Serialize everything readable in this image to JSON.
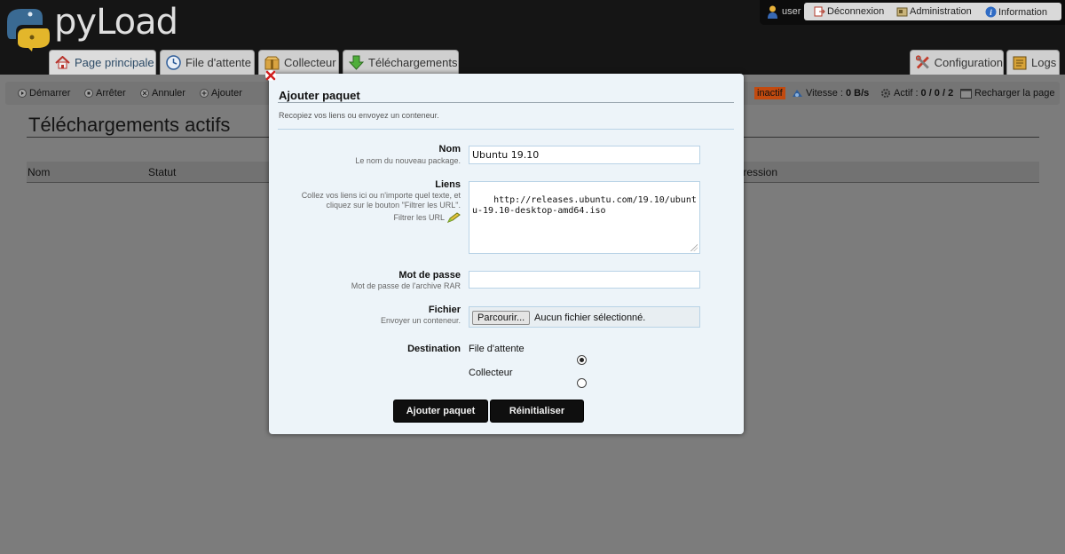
{
  "app": {
    "logo_text": "pyLoad"
  },
  "user": {
    "name": "user",
    "links": {
      "logout": "Déconnexion",
      "admin": "Administration",
      "info": "Information"
    }
  },
  "tabs": {
    "home": "Page principale",
    "queue": "File d'attente",
    "collector": "Collecteur",
    "downloads": "Téléchargements",
    "config": "Configuration",
    "logs": "Logs"
  },
  "actions": {
    "start": "Démarrer",
    "stop": "Arrêter",
    "cancel": "Annuler",
    "add": "Ajouter"
  },
  "status": {
    "state": "inactif",
    "speed_label": "Vitesse : ",
    "speed_value": "0 B/s",
    "active_label": "Actif : ",
    "active_value": "0 / 0 / 2",
    "reload": "Recharger la page"
  },
  "page": {
    "title": "Téléchargements actifs",
    "columns": {
      "name": "Nom",
      "status": "Statut",
      "progress": "Progression"
    }
  },
  "modal": {
    "title": "Ajouter paquet",
    "subtitle": "Recopiez vos liens ou envoyez un conteneur.",
    "name_label": "Nom",
    "name_desc": "Le nom du nouveau package.",
    "name_value": "Ubuntu 19.10",
    "links_label": "Liens",
    "links_desc": "Collez vos liens ici ou n'importe quel texte, et cliquez sur le bouton \"Filtrer les URL\".",
    "links_filter": "Filtrer les URL",
    "links_value": "http://releases.ubuntu.com/19.10/ubuntu-19.10-desktop-amd64.iso",
    "password_label": "Mot de passe",
    "password_desc": "Mot de passe de l'archive RAR",
    "password_value": "",
    "file_label": "Fichier",
    "file_desc": "Envoyer un conteneur.",
    "browse_label": "Parcourir...",
    "file_status": "Aucun fichier sélectionné.",
    "destination_label": "Destination",
    "destinations": [
      {
        "label": "File d'attente",
        "checked": true
      },
      {
        "label": "Collecteur",
        "checked": false
      }
    ],
    "submit_label": "Ajouter paquet",
    "reset_label": "Réinitialiser"
  },
  "colors": {
    "header_bg": "#151515",
    "overlay_bg": "#7c7c7c",
    "modal_bg": "#edf4f9",
    "status_inactive": "#c24a0f",
    "button_dark": "#0f0f0f"
  }
}
